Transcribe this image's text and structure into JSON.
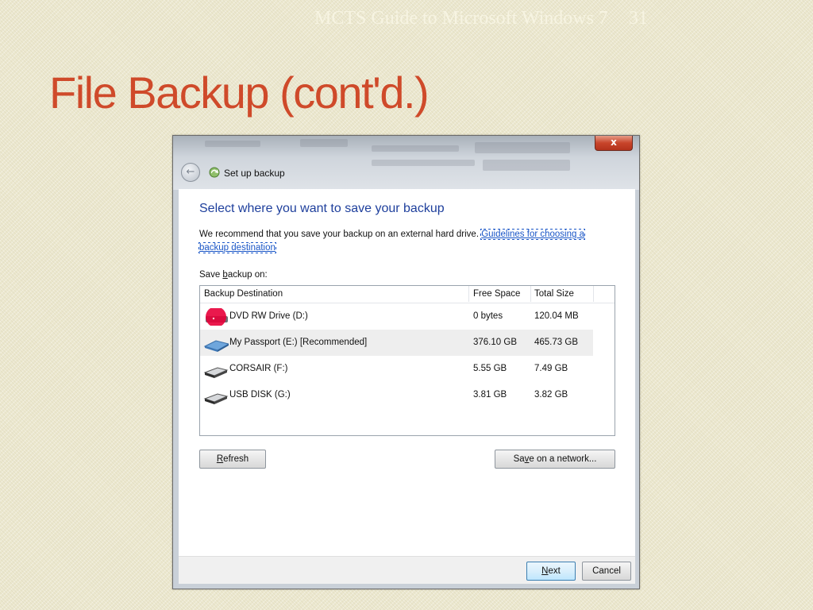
{
  "slide": {
    "header_title": "MCTS Guide to Microsoft Windows 7",
    "page_number": "31",
    "title": "File Backup (cont'd.)"
  },
  "window": {
    "title": "Set up backup",
    "close_glyph": "x"
  },
  "page": {
    "heading": "Select where you want to save your backup",
    "intro_text": "We recommend that you save your backup on an external hard drive.",
    "guidelines_link": "Guidelines for choosing a backup destination",
    "save_label_pre": "Save ",
    "save_label_accel": "b",
    "save_label_post": "ackup on:"
  },
  "table": {
    "columns": [
      "Backup Destination",
      "Free Space",
      "Total Size"
    ],
    "rows": [
      {
        "name": "DVD RW Drive (D:)",
        "free": "0 bytes",
        "total": "120.04 MB",
        "icon": "dvd-drive-icon"
      },
      {
        "name": "My Passport (E:) [Recommended]",
        "free": "376.10 GB",
        "total": "465.73 GB",
        "icon": "external-drive-icon"
      },
      {
        "name": "CORSAIR (F:)",
        "free": "5.55 GB",
        "total": "7.49 GB",
        "icon": "usb-drive-icon"
      },
      {
        "name": "USB DISK (G:)",
        "free": "3.81 GB",
        "total": "3.82 GB",
        "icon": "usb-drive-icon"
      }
    ]
  },
  "buttons": {
    "refresh_accel": "R",
    "refresh_rest": "efresh",
    "network_pre": "Sa",
    "network_accel": "v",
    "network_post": "e on a network...",
    "next_accel": "N",
    "next_rest": "ext",
    "cancel": "Cancel"
  },
  "colors": {
    "slide_title": "#cf4a2a",
    "heading": "#1e3f9c",
    "link": "#1a56c7",
    "highlight_marker": "#e8003a"
  }
}
